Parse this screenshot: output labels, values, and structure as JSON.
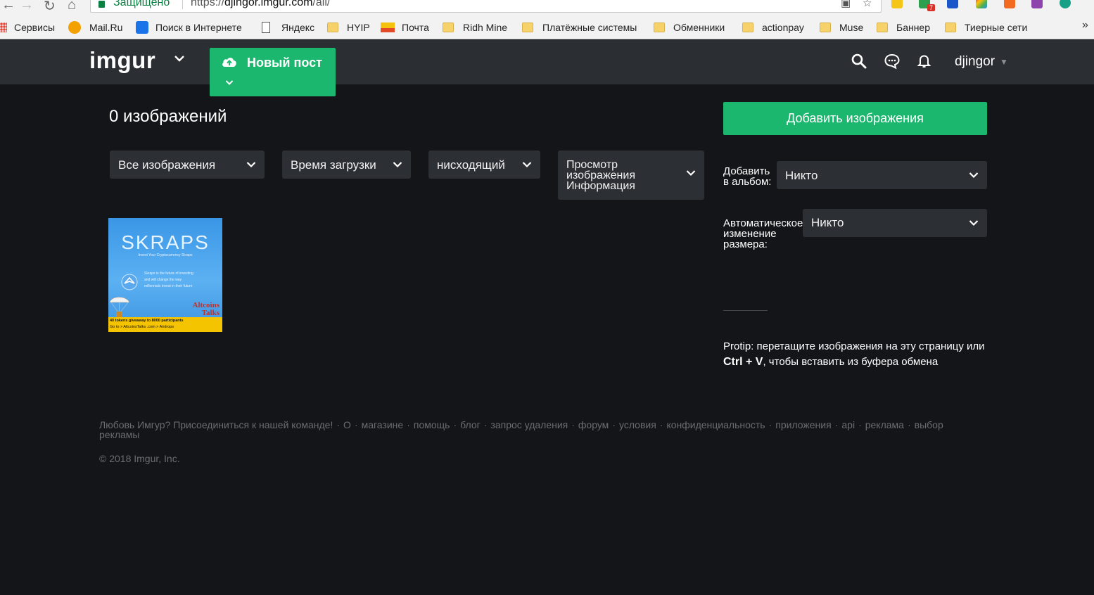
{
  "browser": {
    "secure_label": "Защищено",
    "url_scheme": "https://",
    "url_host": "djingor.imgur.com",
    "url_path": "/all/"
  },
  "bookmarks": [
    {
      "label": "Сервисы",
      "icon": "apps-grid-icon"
    },
    {
      "label": "Mail.Ru",
      "icon": "mailru-icon"
    },
    {
      "label": "Поиск в Интернете",
      "icon": "search-q-icon"
    },
    {
      "label": "Яндекс",
      "icon": "page-icon"
    },
    {
      "label": "HYIP",
      "icon": "folder-icon"
    },
    {
      "label": "Почта",
      "icon": "mail-envelope-icon"
    },
    {
      "label": "Ridh Mine",
      "icon": "folder-icon"
    },
    {
      "label": "Платёжные системы",
      "icon": "folder-icon"
    },
    {
      "label": "Обменники",
      "icon": "folder-icon"
    },
    {
      "label": "actionpay",
      "icon": "folder-icon"
    },
    {
      "label": "Muse",
      "icon": "folder-icon"
    },
    {
      "label": "Баннер",
      "icon": "folder-icon"
    },
    {
      "label": "Тиерные сети",
      "icon": "folder-icon"
    }
  ],
  "extension_badge": "7",
  "header": {
    "logo": "imgur",
    "new_post": "Новый пост",
    "username": "djingor"
  },
  "main": {
    "image_count": "0 изображений",
    "filters": {
      "images": "Все изображения",
      "sort": "Время загрузки",
      "order": "нисходящий",
      "view_lines": [
        "Просмотр",
        "изображения",
        "Информация"
      ]
    },
    "thumbnail": {
      "brand": "SKRAPS",
      "tagline": "Invest Your Cryptocurrency Skraps",
      "desc_lines": [
        "Skraps is the future of investing",
        "and will change the way",
        "millennials invest in their future"
      ],
      "partner_lines": [
        "Altcoins",
        "Talks"
      ],
      "banner_line1": "40 tokens giveaway to 8000 participants",
      "banner_line2": "Go to > AltcoinsTalks .com > Airdrops"
    }
  },
  "sidebar": {
    "add_images": "Добавить изображения",
    "album_label_lines": [
      "Добавить",
      "в альбом:"
    ],
    "album_value": "Никто",
    "resize_label_lines": [
      "Автоматическое",
      "изменение",
      "размера:"
    ],
    "resize_value": "Никто",
    "protip_prefix": "Protip: перетащите изображения на эту страницу или ",
    "protip_keys": "Ctrl + V",
    "protip_suffix": ", чтобы вставить из буфера обмена"
  },
  "footer": {
    "links": [
      "Любовь Имгур? Присоединиться к нашей команде!",
      "О",
      "магазине",
      "помощь",
      "блог",
      "запрос удаления",
      "форум",
      "условия",
      "конфиденциальность",
      "приложения",
      "api",
      "реклама",
      "выбор рекламы"
    ],
    "copyright": "© 2018 Imgur, Inc."
  },
  "colors": {
    "accent_green": "#1bb76e",
    "header_bg": "#2b2e32",
    "page_bg": "#141518",
    "dropdown_bg": "#2c2f34"
  }
}
